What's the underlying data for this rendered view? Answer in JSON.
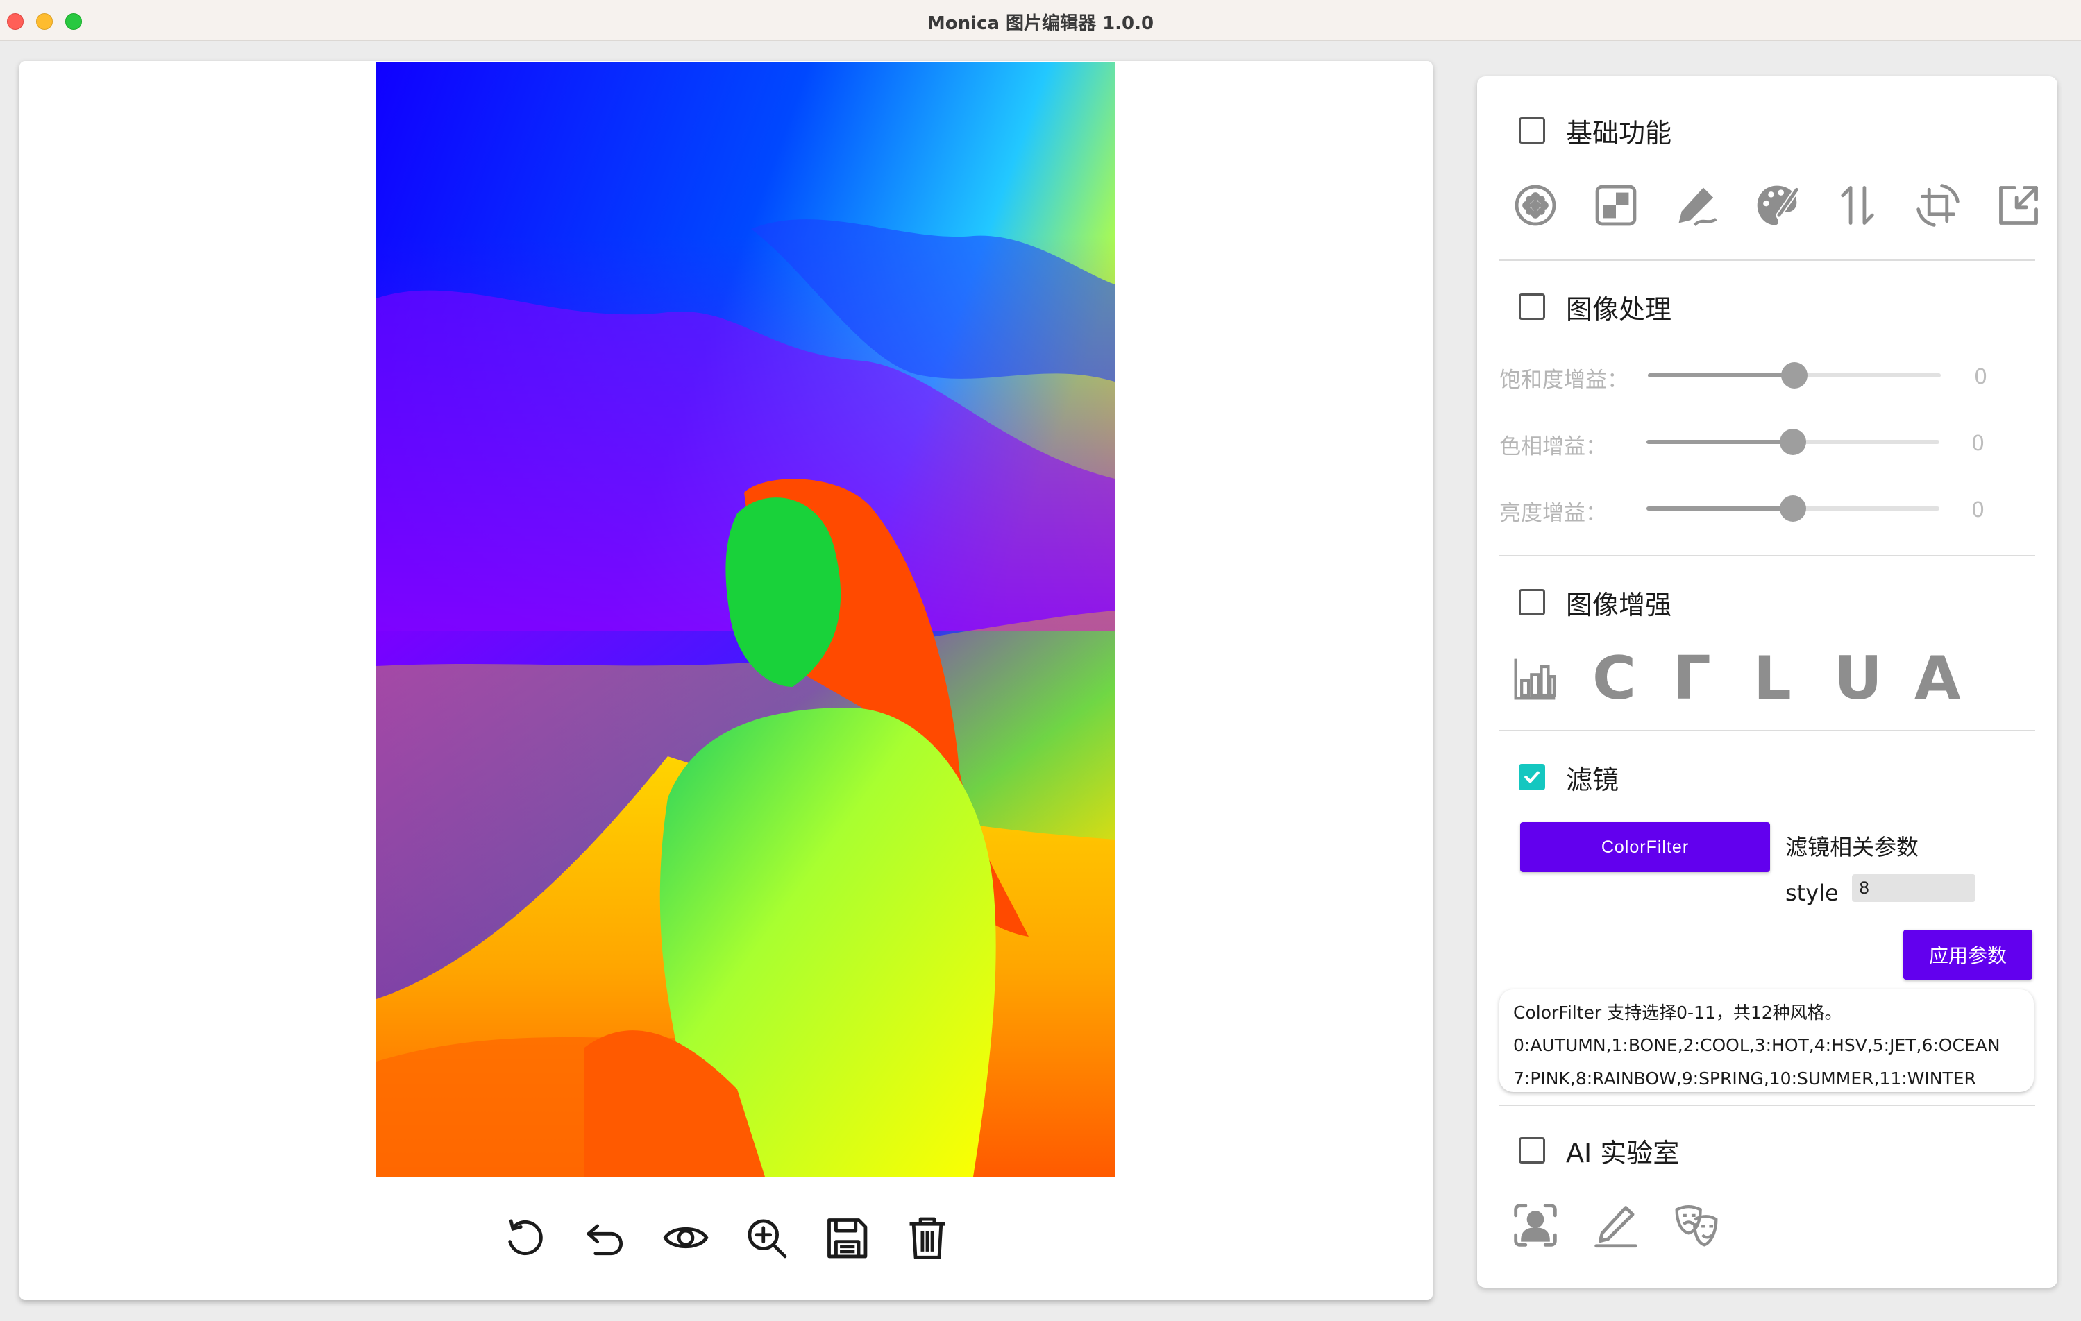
{
  "window": {
    "title": "Monica 图片编辑器 1.0.0"
  },
  "canvas": {
    "image_description_icon": "photo",
    "toolbar": [
      {
        "name": "rotate-icon"
      },
      {
        "name": "undo-icon"
      },
      {
        "name": "eye-icon"
      },
      {
        "name": "zoom-in-icon"
      },
      {
        "name": "save-icon"
      },
      {
        "name": "delete-icon"
      }
    ]
  },
  "panel": {
    "basic": {
      "title": "基础功能",
      "checked": false,
      "icons": [
        "blur-icon",
        "mosaic-icon",
        "doodle-icon",
        "palette-icon",
        "flip-icon",
        "crop-rotate-icon",
        "resize-icon"
      ]
    },
    "image_processing": {
      "title": "图像处理",
      "checked": false,
      "sliders": [
        {
          "label": "饱和度增益：",
          "value": "0",
          "level": 0.5
        },
        {
          "label": "色相增益：",
          "value": "0",
          "level": 0.5
        },
        {
          "label": "亮度增益：",
          "value": "0",
          "level": 0.5
        }
      ]
    },
    "enhance": {
      "title": "图像增强",
      "checked": false,
      "icons": [
        {
          "name": "histogram-icon",
          "letter": ""
        },
        {
          "name": "clahe-icon",
          "letter": "C"
        },
        {
          "name": "gamma-icon",
          "letter": "Γ"
        },
        {
          "name": "laplace-icon",
          "letter": "L"
        },
        {
          "name": "usm-icon",
          "letter": "U"
        },
        {
          "name": "ace-icon",
          "letter": "A"
        }
      ]
    },
    "filter": {
      "title": "滤镜",
      "checked": true,
      "selected_filter": "ColorFilter",
      "params_label": "滤镜相关参数",
      "style_label": "style",
      "style_value": "8",
      "apply_label": "应用参数",
      "info_lines": [
        "ColorFilter 支持选择0-11，共12种风格。",
        "0:AUTUMN,1:BONE,2:COOL,3:HOT,4:HSV,5:JET,6:OCEAN",
        "7:PINK,8:RAINBOW,9:SPRING,10:SUMMER,11:WINTER"
      ]
    },
    "ai_lab": {
      "title": "AI 实验室",
      "checked": false,
      "icons": [
        "face-detect-icon",
        "sketch-icon",
        "cartoon-icon"
      ]
    }
  },
  "colors": {
    "accent": "#6200ee",
    "checkbox_checked": "#14c7c0"
  }
}
